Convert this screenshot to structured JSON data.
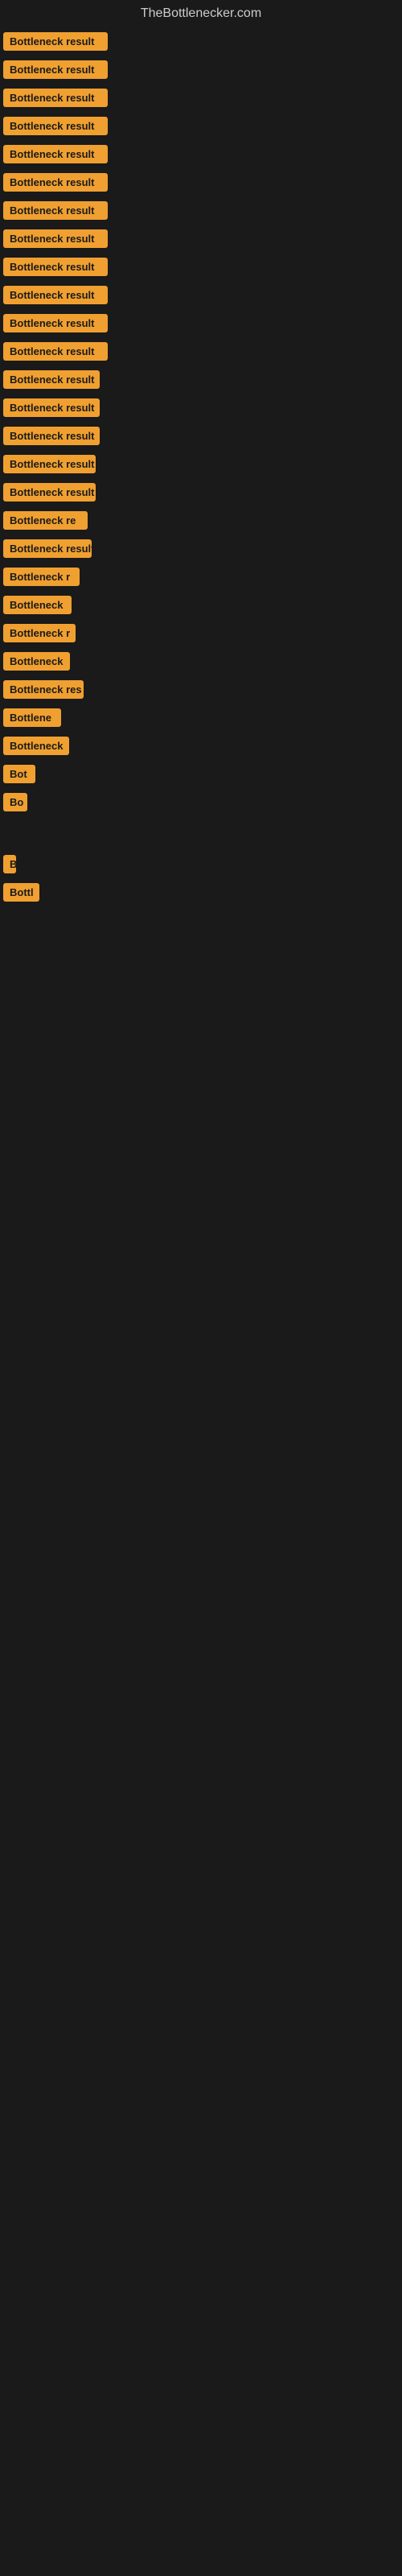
{
  "header": {
    "title": "TheBottlenecker.com"
  },
  "items": [
    {
      "label": "Bottleneck result",
      "width": 130
    },
    {
      "label": "Bottleneck result",
      "width": 130
    },
    {
      "label": "Bottleneck result",
      "width": 130
    },
    {
      "label": "Bottleneck result",
      "width": 130
    },
    {
      "label": "Bottleneck result",
      "width": 130
    },
    {
      "label": "Bottleneck result",
      "width": 130
    },
    {
      "label": "Bottleneck result",
      "width": 130
    },
    {
      "label": "Bottleneck result",
      "width": 130
    },
    {
      "label": "Bottleneck result",
      "width": 130
    },
    {
      "label": "Bottleneck result",
      "width": 130
    },
    {
      "label": "Bottleneck result",
      "width": 130
    },
    {
      "label": "Bottleneck result",
      "width": 130
    },
    {
      "label": "Bottleneck result",
      "width": 120
    },
    {
      "label": "Bottleneck result",
      "width": 120
    },
    {
      "label": "Bottleneck result",
      "width": 120
    },
    {
      "label": "Bottleneck result",
      "width": 115
    },
    {
      "label": "Bottleneck result",
      "width": 115
    },
    {
      "label": "Bottleneck re",
      "width": 105
    },
    {
      "label": "Bottleneck result",
      "width": 110
    },
    {
      "label": "Bottleneck r",
      "width": 95
    },
    {
      "label": "Bottleneck",
      "width": 85
    },
    {
      "label": "Bottleneck r",
      "width": 90
    },
    {
      "label": "Bottleneck",
      "width": 83
    },
    {
      "label": "Bottleneck res",
      "width": 100
    },
    {
      "label": "Bottlene",
      "width": 72
    },
    {
      "label": "Bottleneck",
      "width": 82
    },
    {
      "label": "Bot",
      "width": 40
    },
    {
      "label": "Bo",
      "width": 30
    },
    {
      "label": "",
      "width": 10
    },
    {
      "label": "B",
      "width": 16
    },
    {
      "label": "Bottl",
      "width": 45
    },
    {
      "label": "",
      "width": 8
    },
    {
      "label": "",
      "width": 0
    },
    {
      "label": "",
      "width": 0
    },
    {
      "label": "",
      "width": 0
    },
    {
      "label": "",
      "width": 0
    },
    {
      "label": "",
      "width": 0
    }
  ]
}
